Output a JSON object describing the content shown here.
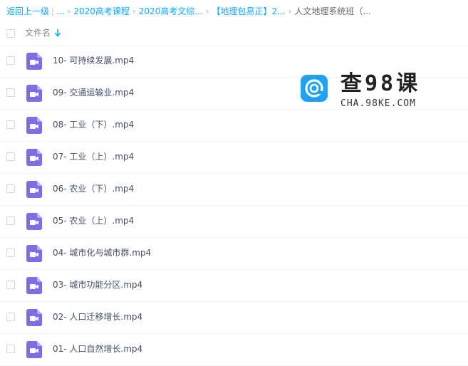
{
  "breadcrumb": {
    "back": "返回上一级",
    "ellipsis": "...",
    "items": [
      "2020高考课程",
      "2020高考文综...",
      "【地理包易正】2..."
    ],
    "current": "人文地理系统班（..."
  },
  "header": {
    "column_label": "文件名"
  },
  "files": [
    "10- 可持续发展.mp4",
    "09- 交通运输业.mp4",
    "08- 工业（下）.mp4",
    "07- 工业（上）.mp4",
    "06- 农业（下）.mp4",
    "05- 农业（上）.mp4",
    "04- 城市化与城市群.mp4",
    "03- 城市功能分区.mp4",
    "02- 人口迁移增长.mp4",
    "01- 人口自然增长.mp4"
  ],
  "watermark": {
    "title": "查98课",
    "subtitle": "CHA.98KE.COM"
  },
  "colors": {
    "link": "#09aaff",
    "file_icon": "#7d6ee8",
    "logo": "#1fa2f5"
  }
}
